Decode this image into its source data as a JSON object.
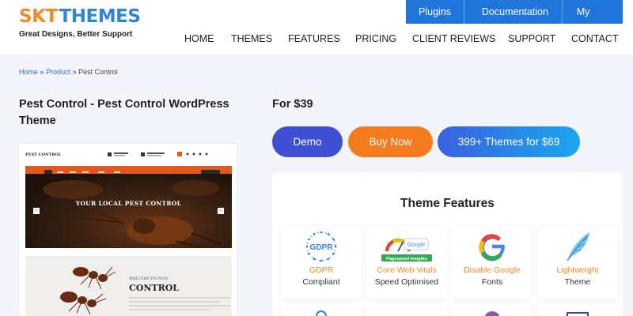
{
  "logo": {
    "brand_left": "SKT",
    "brand_right": "THEMES",
    "tagline": "Great Designs, Better Support"
  },
  "topbar": {
    "plugins": "Plugins",
    "documentation": "Documentation",
    "account": "My Account"
  },
  "nav": [
    "HOME",
    "THEMES",
    "FEATURES",
    "PRICING",
    "CLIENT REVIEWS",
    "SUPPORT",
    "CONTACT"
  ],
  "breadcrumb": {
    "home": "Home",
    "sep": "»",
    "product": "Product",
    "current": "Pest Control"
  },
  "product": {
    "title": "Pest Control - Pest Control WordPress Theme",
    "price": "For $39"
  },
  "buttons": {
    "demo": "Demo",
    "buy": "Buy Now",
    "bundle": "399+ Themes for $69"
  },
  "preview": {
    "logo": "PEST CONTROL",
    "hero": "YOUR LOCAL PEST CONTROL",
    "welcome": "WELCOM TO PEST",
    "control": "CONTROL"
  },
  "features": {
    "title": "Theme Features",
    "items": [
      {
        "icon": "gdpr-icon",
        "line1": "GDPR",
        "line2": "Compliant"
      },
      {
        "icon": "pagespeed-icon",
        "line1": "Core Web Vitals",
        "line2": "Speed Optimised"
      },
      {
        "icon": "google-icon",
        "line1": "Disable Google",
        "line2": "Fonts"
      },
      {
        "icon": "feather-icon",
        "line1": "Lightweight",
        "line2": "Theme"
      }
    ],
    "pagespeed_badge": {
      "google": "Google",
      "insights": "Pagespeed Insights"
    }
  },
  "colors": {
    "accent_blue": "#1f75d9",
    "accent_orange": "#f08a24",
    "demo_button": "#3f4fd3",
    "buy_button": "#f47b1d"
  }
}
